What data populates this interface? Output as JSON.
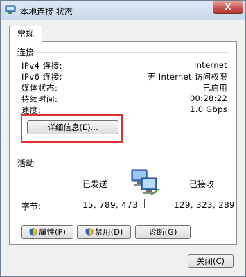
{
  "window": {
    "title": "本地连接 状态",
    "close_label": "X"
  },
  "tab": {
    "label": "常规"
  },
  "connection": {
    "group_label": "连接",
    "rows": [
      {
        "label": "IPv4 连接:",
        "value": "Internet"
      },
      {
        "label": "IPv6 连接:",
        "value": "无 Internet 访问权限"
      },
      {
        "label": "媒体状态:",
        "value": "已启用"
      },
      {
        "label": "持续时间:",
        "value": "00:28:22"
      },
      {
        "label": "速度:",
        "value": "1.0 Gbps"
      }
    ],
    "details_button": "详细信息(E)..."
  },
  "activity": {
    "group_label": "活动",
    "sent_label": "已发送",
    "received_label": "已接收",
    "bytes_label": "字节:",
    "bytes_sent": "15, 789, 473",
    "bytes_received": "129, 323, 289"
  },
  "action_buttons": {
    "properties": "属性(P)",
    "disable": "禁用(D)",
    "diagnose": "诊断(G)"
  },
  "footer": {
    "close_button": "关闭(C)"
  },
  "icons": {
    "title_icon": "network-adapter-icon",
    "shield": "uac-shield-icon",
    "network": "network-computers-icon"
  }
}
